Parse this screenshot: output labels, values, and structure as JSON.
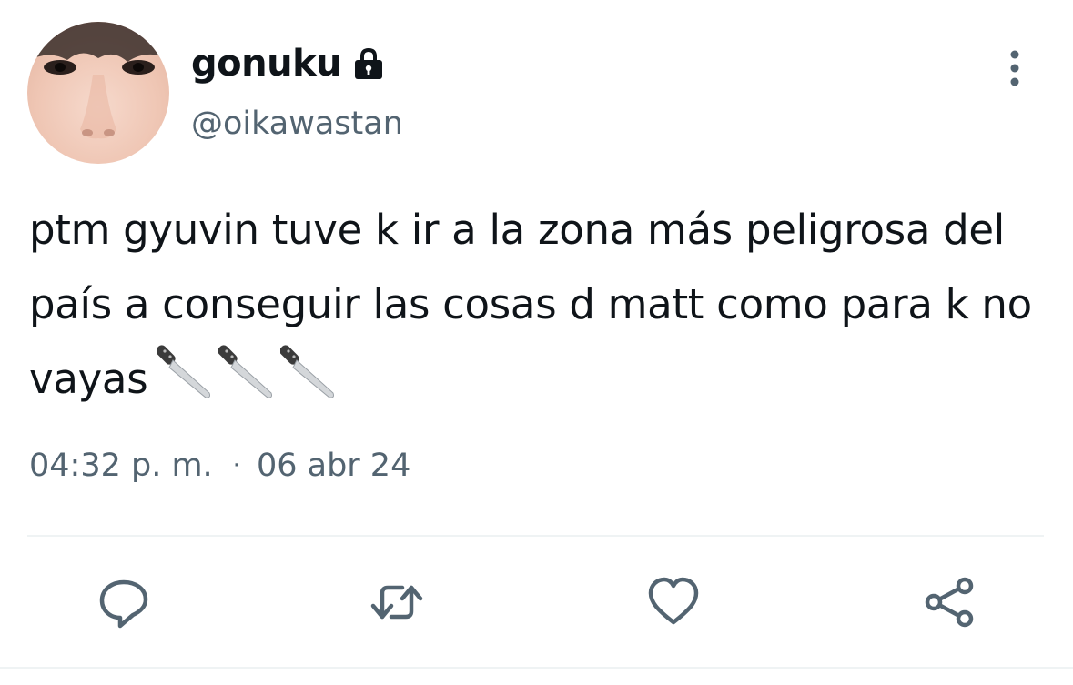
{
  "user": {
    "display_name": "gonuku",
    "handle": "@oikawastan",
    "protected_icon": "lock-icon",
    "avatar": "profile-photo"
  },
  "tweet": {
    "text": "ptm gyuvin tuve k ir a la zona más peligrosa del país a conseguir las cosas d matt como para k no vayas",
    "emojis": [
      "kitchen-knife-icon",
      "kitchen-knife-icon",
      "kitchen-knife-icon"
    ],
    "time": "04:32 p. m.",
    "separator": "·",
    "date": "06 abr 24"
  },
  "actions": [
    {
      "icon": "reply-icon"
    },
    {
      "icon": "retweet-icon"
    },
    {
      "icon": "like-icon"
    },
    {
      "icon": "share-icon"
    }
  ],
  "menu_icon": "more-options-icon",
  "colors": {
    "text_primary": "#0f1419",
    "text_secondary": "#536471",
    "divider": "#eff3f4",
    "icon": "#536471"
  }
}
